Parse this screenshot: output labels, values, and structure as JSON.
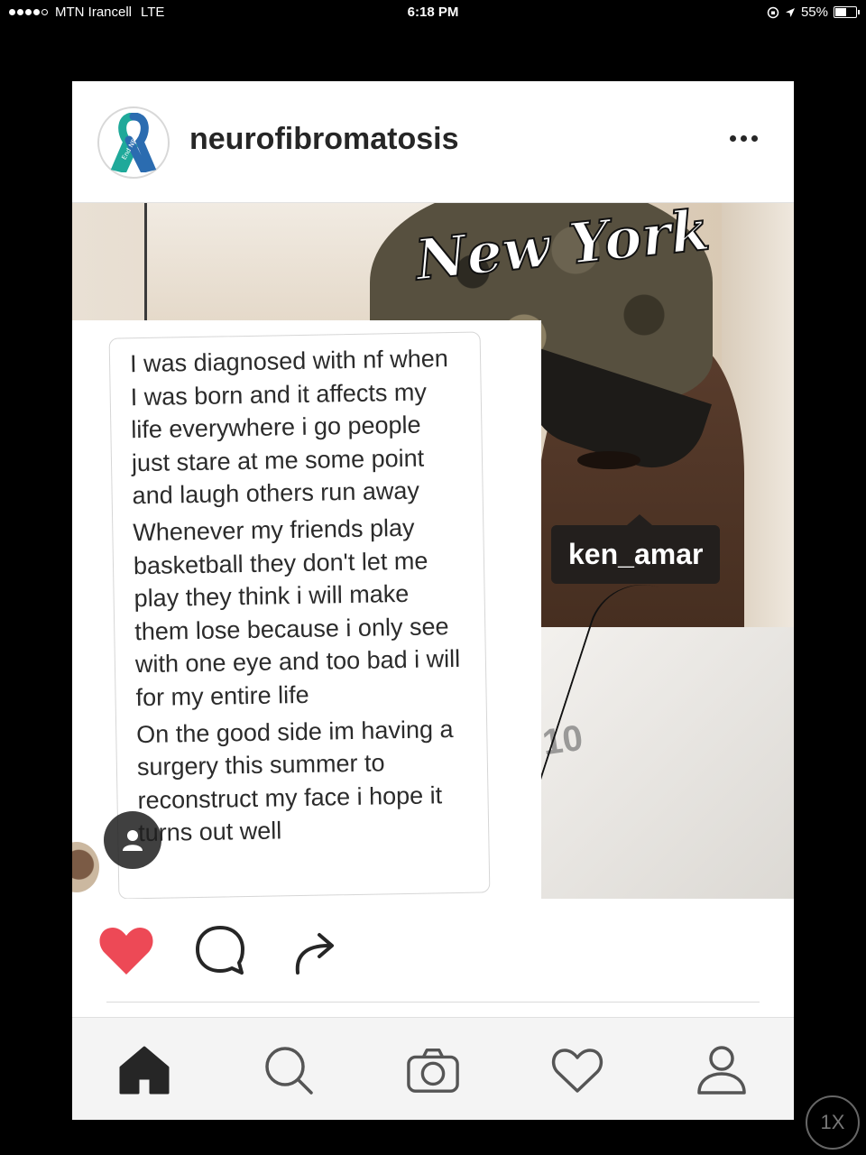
{
  "status_bar": {
    "carrier": "MTN Irancell",
    "network": "LTE",
    "time": "6:18 PM",
    "battery": "55%",
    "battery_level": 0.55,
    "signal_bars": 4
  },
  "post": {
    "account": "neurofibromatosis",
    "avatar_text": "End NF",
    "tagged_user": "ken_amar",
    "note_paragraphs": [
      "I was diagnosed with nf when I was born and it affects my life everywhere i go people just stare at me some point and laugh others run away",
      "Whenever my friends play basketball they don't let me play they think i will make them lose because i only see with one eye and too bad i will for my entire life",
      "On the good side im having a surgery this summer to reconstruct my face i hope it turns out well"
    ],
    "photo_text": {
      "cap": "New York",
      "print": "10"
    },
    "liked": true
  },
  "icons": {
    "more": "more-options-icon",
    "like": "heart-filled-icon",
    "comment": "comment-icon",
    "share": "share-icon",
    "home": "home-icon",
    "search": "search-icon",
    "camera": "camera-icon",
    "activity": "heart-outline-icon",
    "profile": "profile-icon",
    "user_tags": "user-tag-icon"
  },
  "colors": {
    "like_red": "#ed4956",
    "text_dark": "#262626",
    "ribbon_blue": "#2b6cb0",
    "ribbon_teal": "#1fa99a"
  },
  "zoom_button": "1X"
}
